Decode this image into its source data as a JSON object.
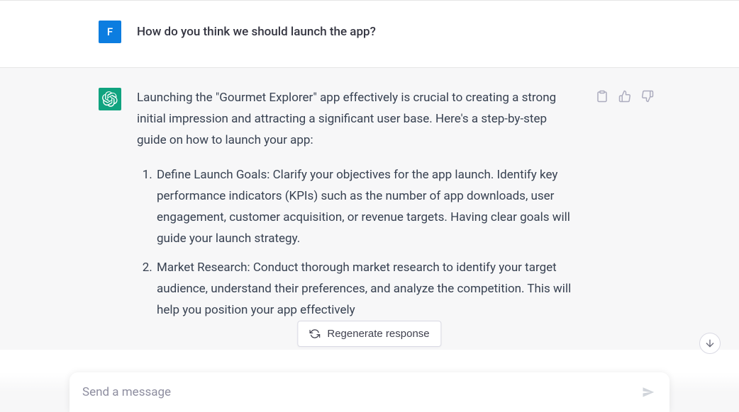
{
  "user": {
    "avatar_letter": "F",
    "message": "How do you think we should launch the app?"
  },
  "assistant": {
    "intro": "Launching the \"Gourmet Explorer\" app effectively is crucial to creating a strong initial impression and attracting a significant user base. Here's a step-by-step guide on how to launch your app:",
    "steps": [
      "Define Launch Goals: Clarify your objectives for the app launch. Identify key performance indicators (KPIs) such as the number of app downloads, user engagement, customer acquisition, or revenue targets. Having clear goals will guide your launch strategy.",
      "Market Research: Conduct thorough market research to identify your target audience, understand their preferences, and analyze the competition. This will help you position your app effectively"
    ]
  },
  "actions": {
    "regenerate_label": "Regenerate response"
  },
  "input": {
    "placeholder": "Send a message"
  }
}
